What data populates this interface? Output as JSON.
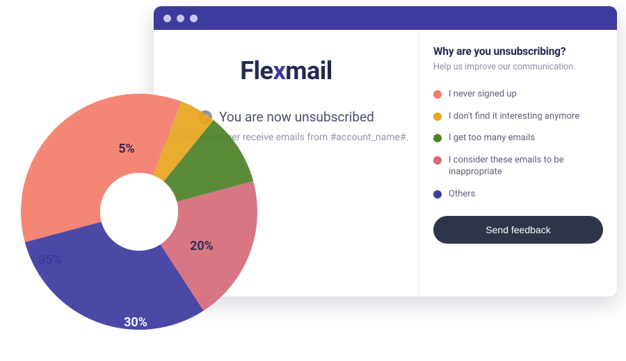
{
  "logo": {
    "pre": "Fle",
    "x": "x",
    "post": "mail"
  },
  "main": {
    "status_heading": "You are now unsubscribed",
    "status_sub": "You will no longer receive emails from #account_name#."
  },
  "panel": {
    "title": "Why are you unsubscribing?",
    "help": "Help us improve our communication.",
    "options": [
      {
        "label": "I never signed up",
        "color": "#f47c6a"
      },
      {
        "label": "I don't find it interesting anymore",
        "color": "#e8a51e"
      },
      {
        "label": "I get too many emails",
        "color": "#4d8128"
      },
      {
        "label": "I consider these emails to be inappropriate",
        "color": "#d56a7a"
      },
      {
        "label": "Others",
        "color": "#3d3a9e"
      }
    ],
    "button_label": "Send feedback"
  },
  "chart_data": {
    "type": "pie",
    "title": "",
    "categories": [
      "I never signed up",
      "I don't find it interesting anymore",
      "I get too many emails",
      "I consider these emails to be inappropriate",
      "Others"
    ],
    "values": [
      35,
      5,
      10,
      20,
      30
    ],
    "colors": [
      "#f47c6a",
      "#e8a51e",
      "#4d8128",
      "#d56a7a",
      "#3d3a9e"
    ],
    "inner_radius_ratio": 0.33,
    "start_angle_deg": 165
  }
}
